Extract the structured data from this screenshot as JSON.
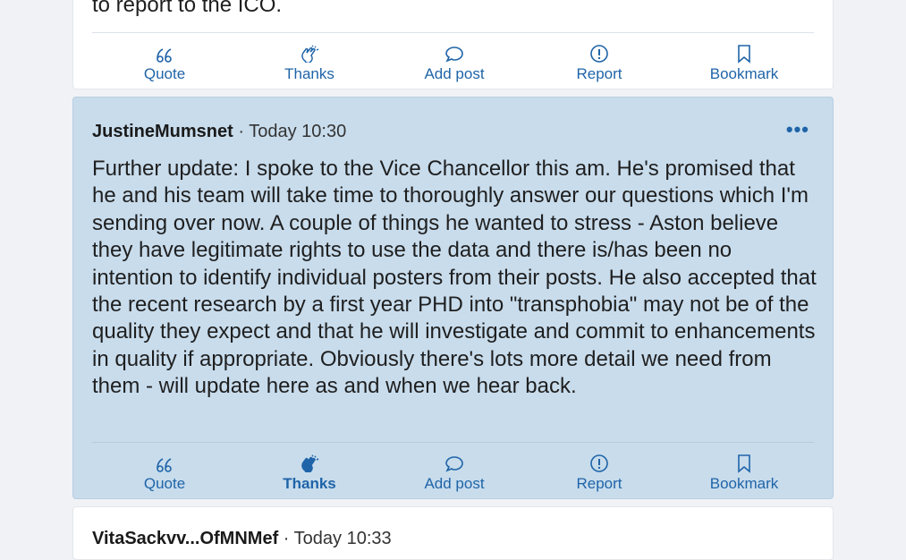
{
  "top_post": {
    "text_tail": "to report to the ICO.",
    "actions": [
      "Quote",
      "Thanks",
      "Add post",
      "Report",
      "Bookmark"
    ]
  },
  "main_post": {
    "author": "JustineMumsnet",
    "separator": " · ",
    "time": "Today 10:30",
    "more": "•••",
    "body": "Further update: I spoke to the Vice Chancellor this am. He's promised that he and his team will take time to thoroughly answer our questions which I'm sending over now. A couple of things he wanted to stress - Aston believe they have legitimate rights to use the data and there is/has been no intention to identify individual posters from their posts. He also accepted that the recent research by a first year PHD into \"transphobia\" may not be of the quality they expect and that he will investigate and commit to enhancements in quality if appropriate. Obviously there's lots more detail we need from them - will update here as and when we hear back.",
    "actions": [
      "Quote",
      "Thanks",
      "Add post",
      "Report",
      "Bookmark"
    ],
    "active_action": "Thanks"
  },
  "next_post": {
    "author": "VitaSackvv...OfMNMef",
    "separator": " · ",
    "time": "Today 10:33"
  },
  "colors": {
    "accent": "#1f64a8",
    "highlight_bg": "#c8dcec",
    "page_bg": "#f0f2f5"
  }
}
